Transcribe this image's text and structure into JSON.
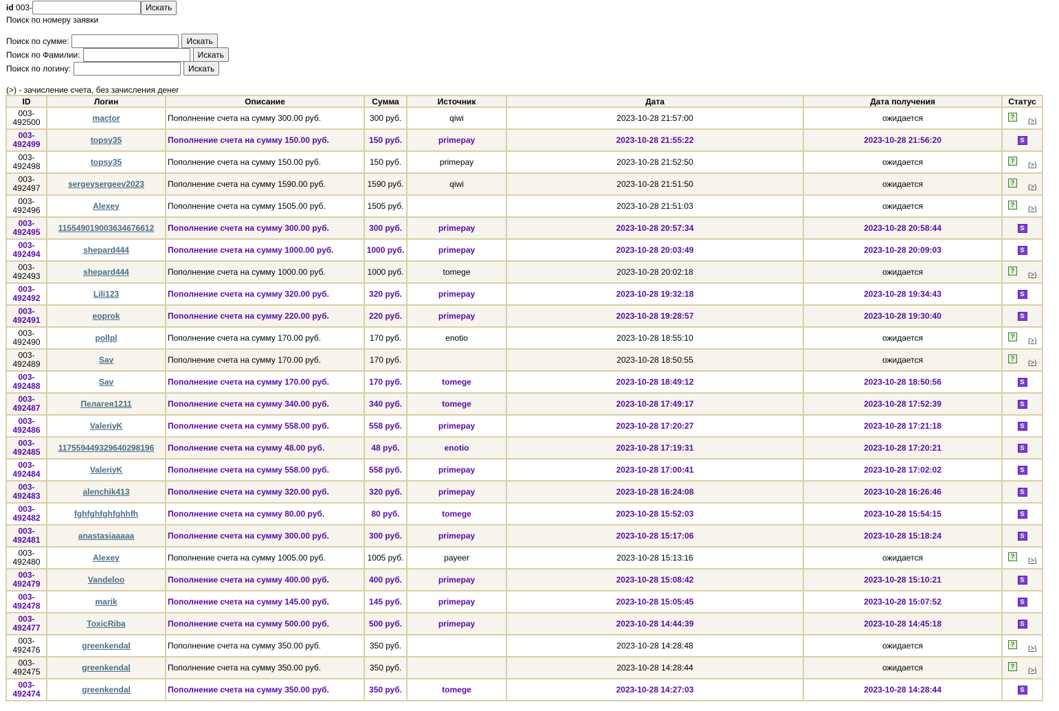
{
  "search": {
    "id_label": "id",
    "id_prefix": "003-",
    "id_button": "Искать",
    "id_note": "Поиск по номеру заявки",
    "sum_label": "Поиск по сумме:",
    "sum_button": "Искать",
    "surname_label": "Поиск по Фамилии:",
    "surname_button": "Искать",
    "login_label": "Поиск по логину:",
    "login_button": "Искать"
  },
  "legend": "(>) - зачисление счета, без зачисления денег",
  "table": {
    "headers": [
      "ID",
      "Логин",
      "Описание",
      "Сумма",
      "Источник",
      "Дата",
      "Дата получения",
      "Статус"
    ],
    "rows": [
      {
        "id": "003-\n492500",
        "login": "mactor",
        "desc": "Пополнение счета на сумму 300.00 руб.",
        "sum": "300 руб.",
        "src": "qiwi",
        "date": "2023-10-28 21:57:00",
        "recv": "ожидается",
        "done": false
      },
      {
        "id": "003-\n492499",
        "login": "topsy35",
        "desc": "Пополнение счета на сумму 150.00 руб.",
        "sum": "150 руб.",
        "src": "primepay",
        "date": "2023-10-28 21:55:22",
        "recv": "2023-10-28 21:56:20",
        "done": true
      },
      {
        "id": "003-\n492498",
        "login": "topsy35",
        "desc": "Пополнение счета на сумму 150.00 руб.",
        "sum": "150 руб.",
        "src": "primepay",
        "date": "2023-10-28 21:52:50",
        "recv": "ожидается",
        "done": false
      },
      {
        "id": "003-\n492497",
        "login": "sergeysergeev2023",
        "desc": "Пополнение счета на сумму 1590.00 руб.",
        "sum": "1590 руб.",
        "src": "qiwi",
        "date": "2023-10-28 21:51:50",
        "recv": "ожидается",
        "done": false
      },
      {
        "id": "003-\n492496",
        "login": "Alexey",
        "desc": "Пополнение счета на сумму 1505.00 руб.",
        "sum": "1505 руб.",
        "src": "",
        "date": "2023-10-28 21:51:03",
        "recv": "ожидается",
        "done": false
      },
      {
        "id": "003-\n492495",
        "login": "115549019003634676612",
        "desc": "Пополнение счета на сумму 300.00 руб.",
        "sum": "300 руб.",
        "src": "primepay",
        "date": "2023-10-28 20:57:34",
        "recv": "2023-10-28 20:58:44",
        "done": true
      },
      {
        "id": "003-\n492494",
        "login": "shepard444",
        "desc": "Пополнение счета на сумму 1000.00 руб.",
        "sum": "1000 руб.",
        "src": "primepay",
        "date": "2023-10-28 20:03:49",
        "recv": "2023-10-28 20:09:03",
        "done": true
      },
      {
        "id": "003-\n492493",
        "login": "shepard444",
        "desc": "Пополнение счета на сумму 1000.00 руб.",
        "sum": "1000 руб.",
        "src": "tomege",
        "date": "2023-10-28 20:02:18",
        "recv": "ожидается",
        "done": false
      },
      {
        "id": "003-\n492492",
        "login": "Lili123",
        "desc": "Пополнение счета на сумму 320.00 руб.",
        "sum": "320 руб.",
        "src": "primepay",
        "date": "2023-10-28 19:32:18",
        "recv": "2023-10-28 19:34:43",
        "done": true
      },
      {
        "id": "003-\n492491",
        "login": "eoprok",
        "desc": "Пополнение счета на сумму 220.00 руб.",
        "sum": "220 руб.",
        "src": "primepay",
        "date": "2023-10-28 19:28:57",
        "recv": "2023-10-28 19:30:40",
        "done": true
      },
      {
        "id": "003-\n492490",
        "login": "pollpl",
        "desc": "Пополнение счета на сумму 170.00 руб.",
        "sum": "170 руб.",
        "src": "enotio",
        "date": "2023-10-28 18:55:10",
        "recv": "ожидается",
        "done": false
      },
      {
        "id": "003-\n492489",
        "login": "Sav",
        "desc": "Пополнение счета на сумму 170.00 руб.",
        "sum": "170 руб.",
        "src": "",
        "date": "2023-10-28 18:50:55",
        "recv": "ожидается",
        "done": false
      },
      {
        "id": "003-\n492488",
        "login": "Sav",
        "desc": "Пополнение счета на сумму 170.00 руб.",
        "sum": "170 руб.",
        "src": "tomege",
        "date": "2023-10-28 18:49:12",
        "recv": "2023-10-28 18:50:56",
        "done": true
      },
      {
        "id": "003-\n492487",
        "login": "Пелагея1211",
        "desc": "Пополнение счета на сумму 340.00 руб.",
        "sum": "340 руб.",
        "src": "tomege",
        "date": "2023-10-28 17:49:17",
        "recv": "2023-10-28 17:52:39",
        "done": true
      },
      {
        "id": "003-\n492486",
        "login": "ValeriyK",
        "desc": "Пополнение счета на сумму 558.00 руб.",
        "sum": "558 руб.",
        "src": "primepay",
        "date": "2023-10-28 17:20:27",
        "recv": "2023-10-28 17:21:18",
        "done": true
      },
      {
        "id": "003-\n492485",
        "login": "117559449329640298196",
        "desc": "Пополнение счета на сумму 48.00 руб.",
        "sum": "48 руб.",
        "src": "enotio",
        "date": "2023-10-28 17:19:31",
        "recv": "2023-10-28 17:20:21",
        "done": true
      },
      {
        "id": "003-\n492484",
        "login": "ValeriyK",
        "desc": "Пополнение счета на сумму 558.00 руб.",
        "sum": "558 руб.",
        "src": "primepay",
        "date": "2023-10-28 17:00:41",
        "recv": "2023-10-28 17:02:02",
        "done": true
      },
      {
        "id": "003-\n492483",
        "login": "alenchik413",
        "desc": "Пополнение счета на сумму 320.00 руб.",
        "sum": "320 руб.",
        "src": "primepay",
        "date": "2023-10-28 16:24:08",
        "recv": "2023-10-28 16:26:46",
        "done": true
      },
      {
        "id": "003-\n492482",
        "login": "fghfghfghfghhfh",
        "desc": "Пополнение счета на сумму 80.00 руб.",
        "sum": "80 руб.",
        "src": "tomege",
        "date": "2023-10-28 15:52:03",
        "recv": "2023-10-28 15:54:15",
        "done": true
      },
      {
        "id": "003-\n492481",
        "login": "anastasiaaaaa",
        "desc": "Пополнение счета на сумму 300.00 руб.",
        "sum": "300 руб.",
        "src": "primepay",
        "date": "2023-10-28 15:17:06",
        "recv": "2023-10-28 15:18:24",
        "done": true
      },
      {
        "id": "003-\n492480",
        "login": "Alexey",
        "desc": "Пополнение счета на сумму 1005.00 руб.",
        "sum": "1005 руб.",
        "src": "payeer",
        "date": "2023-10-28 15:13:16",
        "recv": "ожидается",
        "done": false
      },
      {
        "id": "003-\n492479",
        "login": "Vandeloo",
        "desc": "Пополнение счета на сумму 400.00 руб.",
        "sum": "400 руб.",
        "src": "primepay",
        "date": "2023-10-28 15:08:42",
        "recv": "2023-10-28 15:10:21",
        "done": true
      },
      {
        "id": "003-\n492478",
        "login": "marik",
        "desc": "Пополнение счета на сумму 145.00 руб.",
        "sum": "145 руб.",
        "src": "primepay",
        "date": "2023-10-28 15:05:45",
        "recv": "2023-10-28 15:07:52",
        "done": true
      },
      {
        "id": "003-\n492477",
        "login": "ToxicRiba",
        "desc": "Пополнение счета на сумму 500.00 руб.",
        "sum": "500 руб.",
        "src": "primepay",
        "date": "2023-10-28 14:44:39",
        "recv": "2023-10-28 14:45:18",
        "done": true
      },
      {
        "id": "003-\n492476",
        "login": "greenkendal",
        "desc": "Пополнение счета на сумму 350.00 руб.",
        "sum": "350 руб.",
        "src": "",
        "date": "2023-10-28 14:28:48",
        "recv": "ожидается",
        "done": false
      },
      {
        "id": "003-\n492475",
        "login": "greenkendal",
        "desc": "Пополнение счета на сумму 350.00 руб.",
        "sum": "350 руб.",
        "src": "",
        "date": "2023-10-28 14:28:44",
        "recv": "ожидается",
        "done": false
      },
      {
        "id": "003-\n492474",
        "login": "greenkendal",
        "desc": "Пополнение счета на сумму 350.00 руб.",
        "sum": "350 руб.",
        "src": "tomege",
        "date": "2023-10-28 14:27:03",
        "recv": "2023-10-28 14:28:44",
        "done": true
      }
    ]
  },
  "status_icons": {
    "pending": "question-icon",
    "pending_symbol": "?",
    "credit_link": "(>)",
    "paid": "paid-icon",
    "paid_symbol": "S"
  },
  "colors": {
    "done_text": "#5a0aa8",
    "border": "#d9cfa9",
    "stripe": "#f6f4ec",
    "login_link": "#4a6e88"
  }
}
